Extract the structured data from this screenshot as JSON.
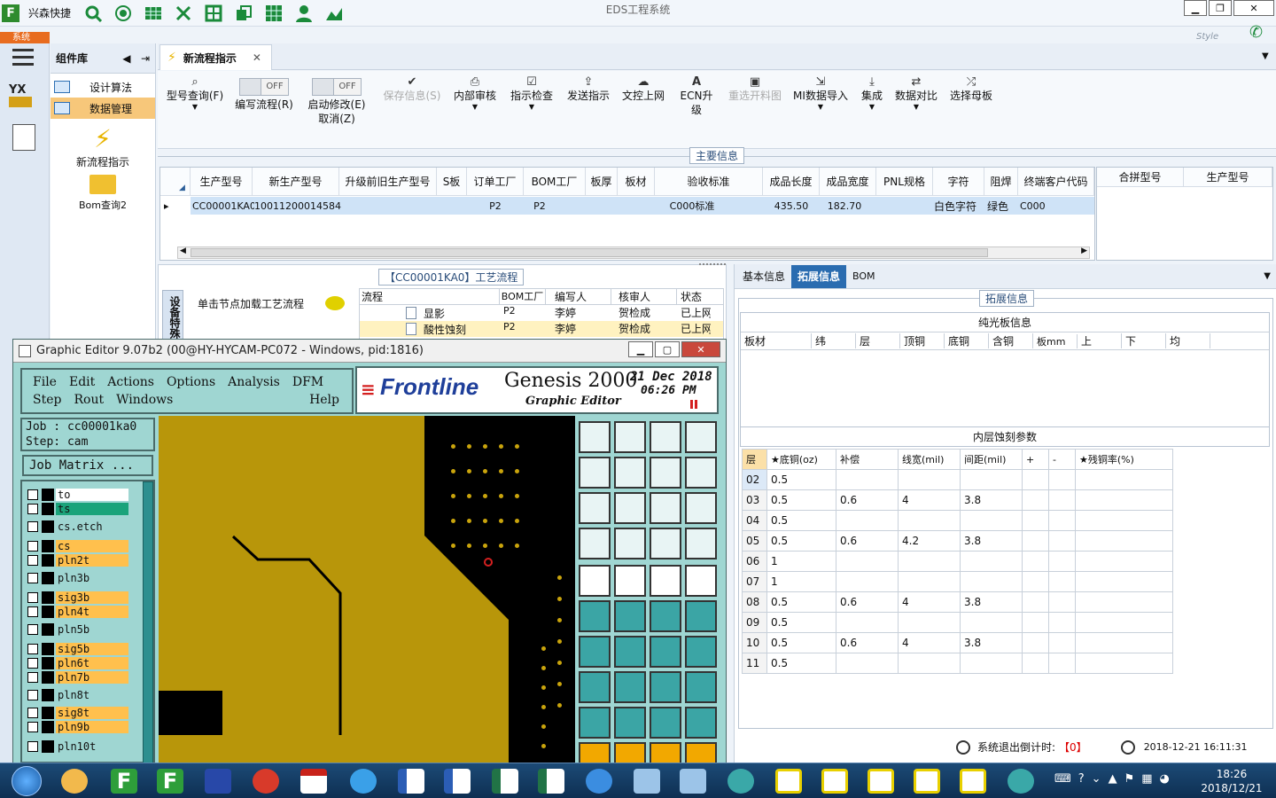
{
  "app": {
    "company": "兴森快捷",
    "title": "EDS工程系统",
    "system_tab": "系统",
    "style_label": "Style"
  },
  "left_panel": {
    "title": "组件库",
    "items": [
      {
        "label": "设计算法"
      },
      {
        "label": "数据管理"
      }
    ],
    "large_items": [
      {
        "label": "新流程指示"
      },
      {
        "label": "Bom查询2"
      }
    ],
    "logo": "YX"
  },
  "tab": {
    "label": "新流程指示"
  },
  "ribbon": {
    "buttons": [
      {
        "label": "型号查询(F)",
        "icon": "search-icon"
      },
      {
        "label": "编写流程(R)",
        "toggle": "OFF"
      },
      {
        "label": "启动修改(E)",
        "toggle": "OFF",
        "sub": "取消(Z)"
      },
      {
        "label": "保存信息(S)",
        "icon": "check-icon",
        "disabled": true
      },
      {
        "label": "内部审核",
        "icon": "printer-icon"
      },
      {
        "label": "指示检查",
        "icon": "checkbox-icon"
      },
      {
        "label": "发送指示",
        "icon": "upload-icon"
      },
      {
        "label": "文控上网",
        "icon": "cloud-upload-icon"
      },
      {
        "label": "ECN升级",
        "icon": "ecn-icon"
      },
      {
        "label": "重选开料图",
        "icon": "image-icon",
        "disabled": true
      },
      {
        "label": "MI数据导入",
        "icon": "import-icon"
      },
      {
        "label": "集成",
        "icon": "download-icon"
      },
      {
        "label": "数据对比",
        "icon": "compare-icon"
      },
      {
        "label": "选择母板",
        "icon": "shuffle-icon"
      }
    ]
  },
  "main_info": {
    "title": "主要信息",
    "columns": [
      "生产型号",
      "新生产型号",
      "升级前旧生产型号",
      "S板",
      "订单工厂",
      "BOM工厂",
      "板厚",
      "板材",
      "验收标准",
      "成品长度",
      "成品宽度",
      "PNL规格",
      "字符",
      "阻焊",
      "终端客户代码"
    ],
    "row": [
      "CC00001KA0",
      "10011200014584",
      "",
      "",
      "P2",
      "P2",
      "",
      "",
      "C000标准",
      "435.50",
      "182.70",
      "",
      "白色字符",
      "绿色",
      "C000"
    ],
    "right_columns": [
      "合拼型号",
      "生产型号"
    ]
  },
  "process": {
    "title": "【CC00001KA0】工艺流程",
    "side_tab": "设备特殊",
    "load_label": "单击节点加载工艺流程",
    "columns": [
      "流程",
      "BOM工厂",
      "编写人",
      "核审人",
      "状态"
    ],
    "rows": [
      {
        "name": "显影",
        "factory": "P2",
        "writer": "李婷",
        "reviewer": "贺检成",
        "status": "已上网"
      },
      {
        "name": "酸性蚀刻",
        "factory": "P2",
        "writer": "李婷",
        "reviewer": "贺检成",
        "status": "已上网"
      }
    ]
  },
  "info_tabs": [
    "基本信息",
    "拓展信息",
    "BOM"
  ],
  "ext_info": {
    "title": "拓展信息",
    "bare_board": {
      "title": "纯光板信息",
      "columns": [
        "板材",
        "纬",
        "层",
        "顶铜",
        "底铜",
        "含铜",
        "板mm",
        "上",
        "下",
        "均"
      ]
    },
    "etch": {
      "title": "内层蚀刻参数",
      "columns": [
        "层",
        "★底铜(oz)",
        "补偿",
        "线宽(mil)",
        "间距(mil)",
        "+",
        "-",
        "★残铜率(%)"
      ],
      "rows": [
        [
          "02",
          "0.5",
          "",
          "",
          "",
          "",
          "",
          ""
        ],
        [
          "03",
          "0.5",
          "0.6",
          "4",
          "3.8",
          "",
          "",
          ""
        ],
        [
          "04",
          "0.5",
          "",
          "",
          "",
          "",
          "",
          ""
        ],
        [
          "05",
          "0.5",
          "0.6",
          "4.2",
          "3.8",
          "",
          "",
          ""
        ],
        [
          "06",
          "1",
          "",
          "",
          "",
          "",
          "",
          ""
        ],
        [
          "07",
          "1",
          "",
          "",
          "",
          "",
          "",
          ""
        ],
        [
          "08",
          "0.5",
          "0.6",
          "4",
          "3.8",
          "",
          "",
          ""
        ],
        [
          "09",
          "0.5",
          "",
          "",
          "",
          "",
          "",
          ""
        ],
        [
          "10",
          "0.5",
          "0.6",
          "4",
          "3.8",
          "",
          "",
          ""
        ],
        [
          "11",
          "0.5",
          "",
          "",
          "",
          "",
          "",
          ""
        ]
      ]
    }
  },
  "status_bar": {
    "countdown_label": "系统退出倒计时:",
    "countdown_value": "【0】",
    "datetime": "2018-12-21 16:11:31"
  },
  "genesis": {
    "title": "Graphic Editor 9.07b2 (00@HY-HYCAM-PC072 - Windows, pid:1816)",
    "menu1": [
      "File",
      "Edit",
      "Actions",
      "Options",
      "Analysis",
      "DFM"
    ],
    "menu2": [
      "Step",
      "Rout",
      "Windows"
    ],
    "help": "Help",
    "brand": "Frontline",
    "product": "Genesis 2000",
    "subtitle": "Graphic Editor",
    "date": "21 Dec 2018",
    "time": "06:26 PM",
    "job": "Job : cc00001ka0",
    "step": "Step: cam",
    "matrix": "Job Matrix ...",
    "layers": [
      {
        "name": "to",
        "color": "#ffffff"
      },
      {
        "name": "ts",
        "color": "#1aa37a"
      },
      {
        "name": "cs.etch",
        "color": "#9fd6d2"
      },
      {
        "name": "cs",
        "color": "#ffc04d"
      },
      {
        "name": "pln2t",
        "color": "#ffc04d"
      },
      {
        "name": "pln3b",
        "color": "#9fd6d2"
      },
      {
        "name": "sig3b",
        "color": "#ffc04d"
      },
      {
        "name": "pln4t",
        "color": "#ffc04d"
      },
      {
        "name": "pln5b",
        "color": "#9fd6d2"
      },
      {
        "name": "sig5b",
        "color": "#ffc04d"
      },
      {
        "name": "pln6t",
        "color": "#ffc04d"
      },
      {
        "name": "pln7b",
        "color": "#ffc04d"
      },
      {
        "name": "pln8t",
        "color": "#9fd6d2"
      },
      {
        "name": "sig8t",
        "color": "#ffc04d"
      },
      {
        "name": "pln9b",
        "color": "#ffc04d"
      },
      {
        "name": "pln10t",
        "color": "#9fd6d2"
      }
    ]
  },
  "taskbar": {
    "time": "18:26",
    "date": "2018/12/21"
  }
}
